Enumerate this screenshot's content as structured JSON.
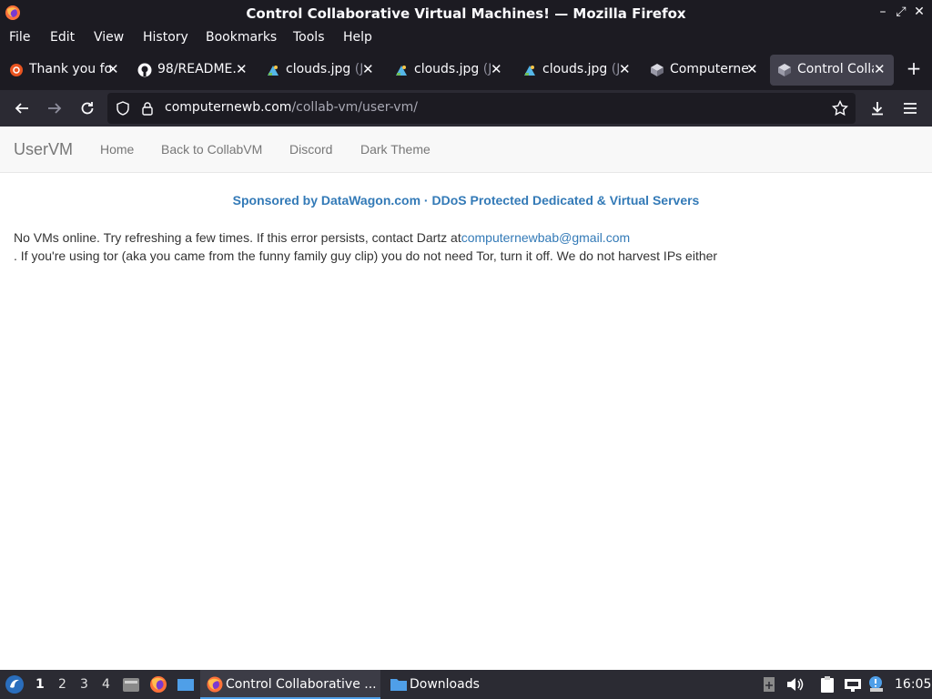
{
  "window": {
    "title": "Control Collaborative Virtual Machines! — Mozilla Firefox"
  },
  "menu": [
    "File",
    "Edit",
    "View",
    "History",
    "Bookmarks",
    "Tools",
    "Help"
  ],
  "tabs": [
    {
      "label": "Thank you fo",
      "suffix": "",
      "icon": "ubuntu-icon"
    },
    {
      "label": "98/README.",
      "suffix": "",
      "icon": "github-icon"
    },
    {
      "label": "clouds.jpg",
      "suffix": " (J",
      "icon": "image-icon"
    },
    {
      "label": "clouds.jpg",
      "suffix": " (J",
      "icon": "image-icon"
    },
    {
      "label": "clouds.jpg",
      "suffix": " (J",
      "icon": "image-icon"
    },
    {
      "label": "Computerne",
      "suffix": "",
      "icon": "collabvm-icon"
    },
    {
      "label": "Control Colla",
      "suffix": "",
      "icon": "collabvm-icon",
      "active": true
    }
  ],
  "url": {
    "host": "computernewb.com",
    "path": "/collab-vm/user-vm/"
  },
  "site": {
    "brand": "UserVM",
    "nav": [
      "Home",
      "Back to CollabVM",
      "Discord",
      "Dark Theme"
    ],
    "sponsor_a": "Sponsored by DataWagon.com",
    "sponsor_sep": " · ",
    "sponsor_b": "DDoS Protected Dedicated & Virtual Servers",
    "msg_line1": "No VMs online. Try refreshing a few times. If this error persists, contact Dartz at",
    "msg_email": "computernewbab@gmail.com",
    "msg_line2": ". If you're using tor (aka you came from the funny family guy clip) you do not need Tor, turn it off. We do not harvest IPs either"
  },
  "taskbar": {
    "workspaces": [
      "1",
      "2",
      "3",
      "4"
    ],
    "tasks": [
      {
        "label": "Control Collaborative ...",
        "active": true
      },
      {
        "label": "Downloads",
        "active": false
      }
    ],
    "clock": "16:05"
  },
  "colors": {
    "accent": "#337ab7",
    "chrome_dark": "#1c1b22",
    "toolbar": "#2b2a33"
  }
}
